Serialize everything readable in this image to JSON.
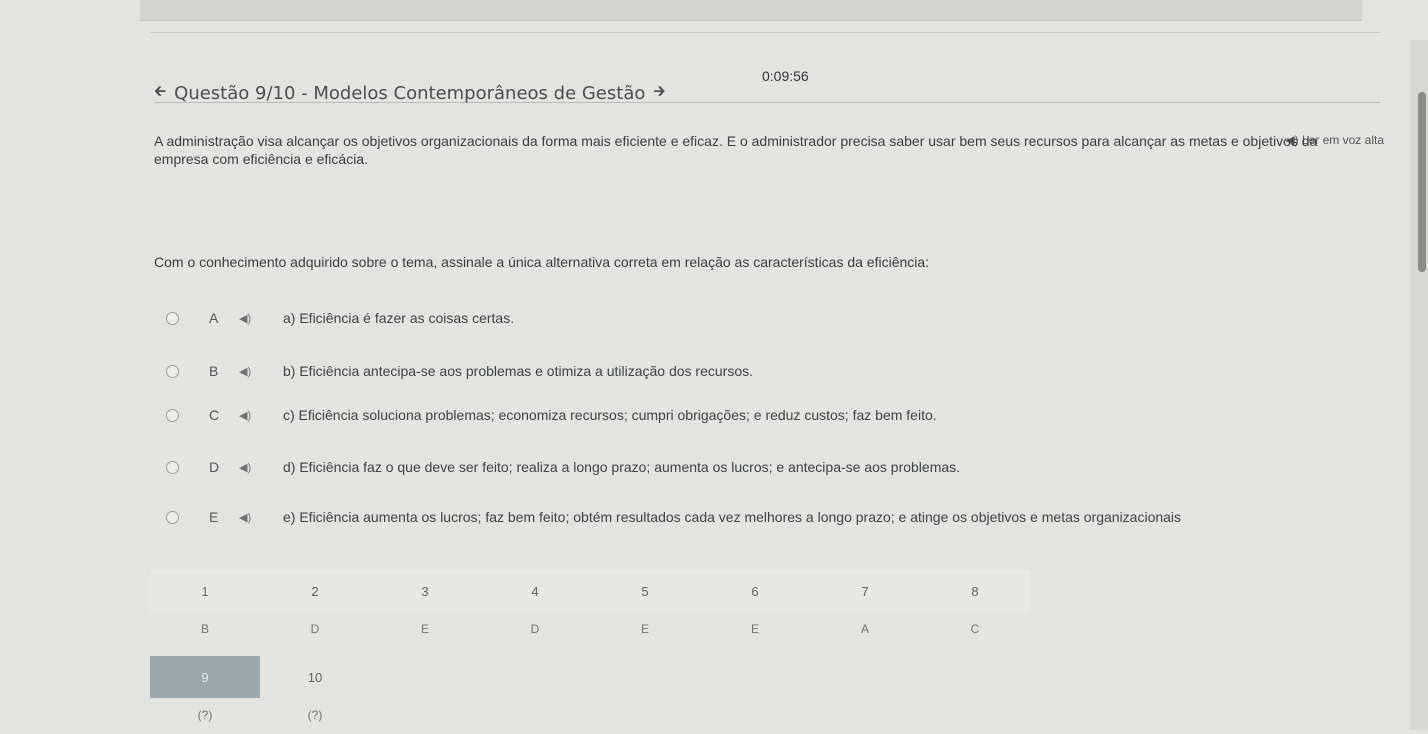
{
  "timer": "0:09:56",
  "header": {
    "title": "Questão 9/10 - Modelos Contemporâneos de Gestão",
    "prev_icon": "arrow-left-icon",
    "next_icon": "arrow-right-icon"
  },
  "tts_label": "Ler em voz alta",
  "statement": "A administração visa alcançar os objetivos organizacionais da forma mais eficiente e eficaz. E o administrador precisa saber usar bem seus recursos para alcançar as metas e objetivos da empresa com eficiência e eficácia.",
  "prompt": "Com o conhecimento adquirido sobre o tema, assinale a única alternativa correta em relação as características da eficiência:",
  "options": [
    {
      "letter": "A",
      "text": "a) Eficiência é fazer as coisas certas."
    },
    {
      "letter": "B",
      "text": "b) Eficiência antecipa-se aos problemas e otimiza a utilização dos recursos."
    },
    {
      "letter": "C",
      "text": "c) Eficiência soluciona problemas; economiza recursos; cumpri obrigações; e reduz custos; faz bem feito."
    },
    {
      "letter": "D",
      "text": "d) Eficiência faz o que deve ser feito; realiza a longo prazo; aumenta os lucros; e antecipa-se aos problemas."
    },
    {
      "letter": "E",
      "text": "e) Eficiência aumenta os lucros; faz bem feito; obtém resultados cada vez melhores a longo prazo; e atinge os objetivos e metas organizacionais"
    }
  ],
  "navigator": {
    "questions": [
      {
        "num": "1",
        "answer": "B"
      },
      {
        "num": "2",
        "answer": "D"
      },
      {
        "num": "3",
        "answer": "E"
      },
      {
        "num": "4",
        "answer": "D"
      },
      {
        "num": "5",
        "answer": "E"
      },
      {
        "num": "6",
        "answer": "E"
      },
      {
        "num": "7",
        "answer": "A"
      },
      {
        "num": "8",
        "answer": "C"
      }
    ],
    "row2": [
      {
        "num": "9",
        "answer": "(?)"
      },
      {
        "num": "10",
        "answer": "(?)"
      }
    ]
  },
  "colors": {
    "background": "#e3e4e1",
    "active_cell": "#9aa7ac"
  }
}
